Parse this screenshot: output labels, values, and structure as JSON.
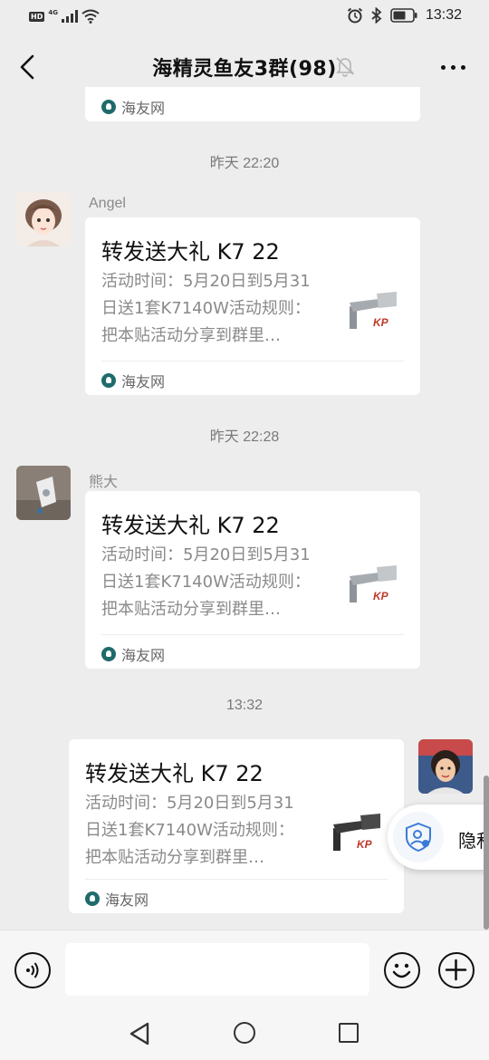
{
  "status_bar": {
    "hd": "HD",
    "network": "4G",
    "time": "13:32"
  },
  "header": {
    "title": "海精灵鱼友3群(98)",
    "back_icon": "chevron-left-icon",
    "mute_icon": "bell-off-icon",
    "more_icon": "more-dots-icon"
  },
  "partial_card": {
    "source": "海友网"
  },
  "messages": [
    {
      "timestamp": "昨天 22:20",
      "sender": "Angel",
      "title": "转发送大礼 K7 22",
      "description": "活动时间：5月20日到5月31日送1套K7140W活动规则：把本贴活动分享到群里…",
      "source": "海友网"
    },
    {
      "timestamp": "昨天 22:28",
      "sender": "熊大",
      "title": "转发送大礼 K7 22",
      "description": "活动时间：5月20日到5月31日送1套K7140W活动规则：把本贴活动分享到群里…",
      "source": "海友网"
    },
    {
      "timestamp": "13:32",
      "sender": "",
      "title": "转发送大礼 K7 22",
      "description": "活动时间：5月20日到5月31日送1套K7140W活动规则：把本贴活动分享到群里…",
      "source": "海友网"
    }
  ],
  "privacy_button": {
    "label": "隐私"
  },
  "input_bar": {
    "message_value": "",
    "voice_icon": "voice-icon",
    "emoji_icon": "emoji-icon",
    "plus_icon": "plus-icon"
  },
  "colors": {
    "background": "#ededed",
    "card": "#ffffff",
    "muted_text": "#8a8a8a"
  }
}
